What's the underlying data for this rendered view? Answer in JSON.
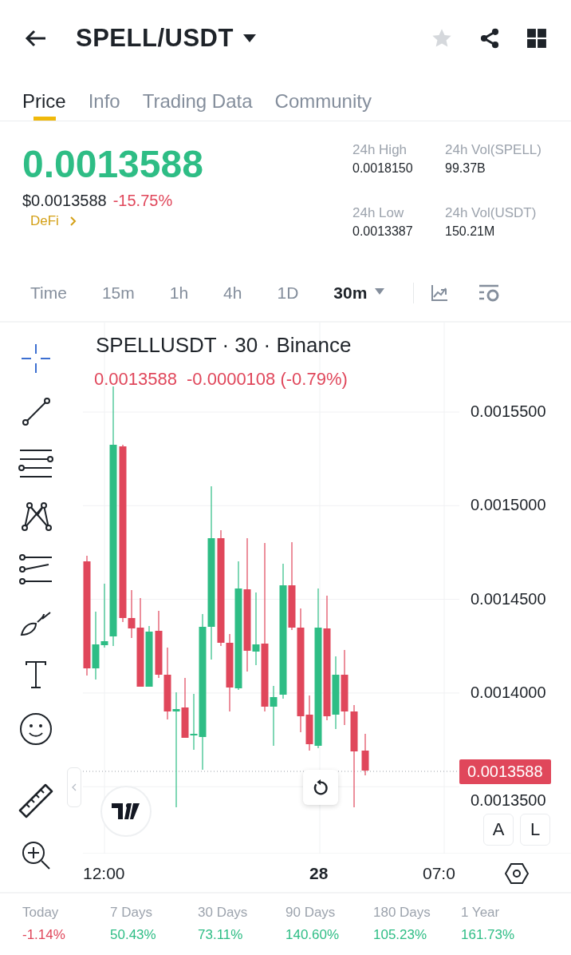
{
  "header": {
    "title": "SPELL/USDT",
    "favorite": false
  },
  "tabs": [
    {
      "label": "Price",
      "selected": true
    },
    {
      "label": "Info",
      "selected": false
    },
    {
      "label": "Trading Data",
      "selected": false
    },
    {
      "label": "Community",
      "selected": false
    }
  ],
  "price": {
    "last": "0.0013588",
    "usd": "$0.0013588",
    "change": "-15.75%",
    "tag": "DeFi"
  },
  "stats": [
    {
      "label": "24h High",
      "value": "0.0018150"
    },
    {
      "label": "24h Vol(SPELL)",
      "value": "99.37B"
    },
    {
      "label": "24h Low",
      "value": "0.0013387"
    },
    {
      "label": "24h Vol(USDT)",
      "value": "150.21M"
    }
  ],
  "intervals": [
    {
      "label": "Time",
      "selected": false,
      "dropdown": false
    },
    {
      "label": "15m",
      "selected": false,
      "dropdown": false
    },
    {
      "label": "1h",
      "selected": false,
      "dropdown": false
    },
    {
      "label": "4h",
      "selected": false,
      "dropdown": false
    },
    {
      "label": "1D",
      "selected": false,
      "dropdown": false
    },
    {
      "label": "30m",
      "selected": true,
      "dropdown": true
    }
  ],
  "chart": {
    "legend": "SPELLUSDT · 30 · Binance",
    "last": "0.0013588",
    "change": "-0.0000108 (-0.79%)",
    "y_axis": [
      "0.0015500",
      "0.0015000",
      "0.0014500",
      "0.0014000",
      "0.0013500"
    ],
    "price_tag": "0.0013588",
    "x_axis": [
      {
        "label": "12:00",
        "bold": false
      },
      {
        "label": "28",
        "bold": true
      },
      {
        "label": "07:0",
        "bold": false
      }
    ],
    "scale_buttons": [
      "A",
      "L"
    ]
  },
  "periods": [
    {
      "label": "Today",
      "value": "-1.14%",
      "negative": true
    },
    {
      "label": "7 Days",
      "value": "50.43%",
      "negative": false
    },
    {
      "label": "30 Days",
      "value": "73.11%",
      "negative": false
    },
    {
      "label": "90 Days",
      "value": "140.60%",
      "negative": false
    },
    {
      "label": "180 Days",
      "value": "105.23%",
      "negative": false
    },
    {
      "label": "1 Year",
      "value": "161.73%",
      "negative": false
    }
  ]
}
